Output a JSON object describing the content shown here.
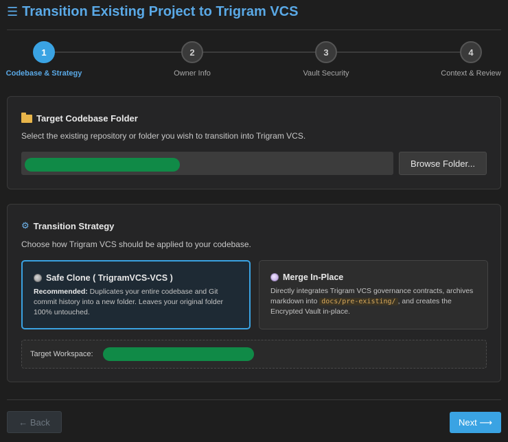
{
  "title": {
    "icon": "list-icon",
    "icon_glyph": "☰",
    "text": "Transition Existing Project to Trigram VCS"
  },
  "stepper": {
    "steps": [
      {
        "number": "1",
        "label": "Codebase & Strategy",
        "active": true
      },
      {
        "number": "2",
        "label": "Owner Info",
        "active": false
      },
      {
        "number": "3",
        "label": "Vault Security",
        "active": false
      },
      {
        "number": "4",
        "label": "Context & Review",
        "active": false
      }
    ]
  },
  "codebase_panel": {
    "icon": "folder-icon",
    "title": "Target Codebase Folder",
    "description": "Select the existing repository or folder you wish to transition into Trigram VCS.",
    "path_value": "",
    "browse_label": "Browse Folder..."
  },
  "strategy_panel": {
    "icon": "gear-icon",
    "icon_glyph": "⚙",
    "title": "Transition Strategy",
    "description": "Choose how Trigram VCS should be applied to your codebase.",
    "safe_clone": {
      "title": "Safe Clone ( TrigramVCS-VCS )",
      "recommended_label": "Recommended:",
      "body": " Duplicates your entire codebase and Git commit history into a new folder. Leaves your original folder 100% untouched."
    },
    "merge_in_place": {
      "title": "Merge In-Place",
      "body_before": "Directly integrates Trigram VCS governance contracts, archives markdown into ",
      "code": "docs/pre-existing/",
      "body_after": ", and creates the Encrypted Vault in-place."
    },
    "workspace_label": "Target Workspace:"
  },
  "footer": {
    "back_label": "← Back",
    "next_label": "Next ⟶"
  },
  "colors": {
    "accent": "#3aa3e3",
    "redaction": "#108a47",
    "background": "#1e1e1e"
  }
}
